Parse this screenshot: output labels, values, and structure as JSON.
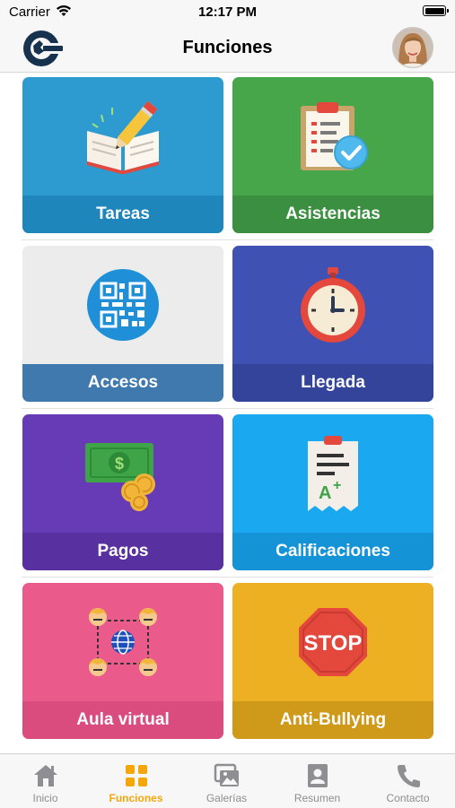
{
  "status_bar": {
    "carrier": "Carrier",
    "time": "12:17 PM"
  },
  "nav": {
    "title": "Funciones"
  },
  "tiles": [
    {
      "label": "Tareas",
      "icon": "notebook-pencil-icon",
      "bg": "#2e9bd0",
      "label_bg": "#1e86bb"
    },
    {
      "label": "Asistencias",
      "icon": "clipboard-check-icon",
      "bg": "#47a649",
      "label_bg": "#3a9040"
    },
    {
      "label": "Accesos",
      "icon": "qr-code-icon",
      "bg": "#ececec",
      "label_bg": "#3f79ad"
    },
    {
      "label": "Llegada",
      "icon": "stopwatch-icon",
      "bg": "#3f52b4",
      "label_bg": "#34449b"
    },
    {
      "label": "Pagos",
      "icon": "money-coins-icon",
      "bg": "#683bb6",
      "label_bg": "#58309f"
    },
    {
      "label": "Calificaciones",
      "icon": "grade-report-icon",
      "bg": "#1aa9f0",
      "label_bg": "#1494d6"
    },
    {
      "label": "Aula virtual",
      "icon": "virtual-classroom-icon",
      "bg": "#ea5b8c",
      "label_bg": "#d94c7d"
    },
    {
      "label": "Anti-Bullying",
      "icon": "stop-sign-icon",
      "bg": "#ecb022",
      "label_bg": "#cf9a1a"
    }
  ],
  "tabs": [
    {
      "label": "Inicio",
      "icon": "home-icon",
      "active": false
    },
    {
      "label": "Funciones",
      "icon": "grid-icon",
      "active": true
    },
    {
      "label": "Galerías",
      "icon": "gallery-icon",
      "active": false
    },
    {
      "label": "Resumen",
      "icon": "profile-card-icon",
      "active": false
    },
    {
      "label": "Contacto",
      "icon": "phone-icon",
      "active": false
    }
  ],
  "colors": {
    "accent": "#f5a70a",
    "inactive_tab": "#8e8e93"
  }
}
